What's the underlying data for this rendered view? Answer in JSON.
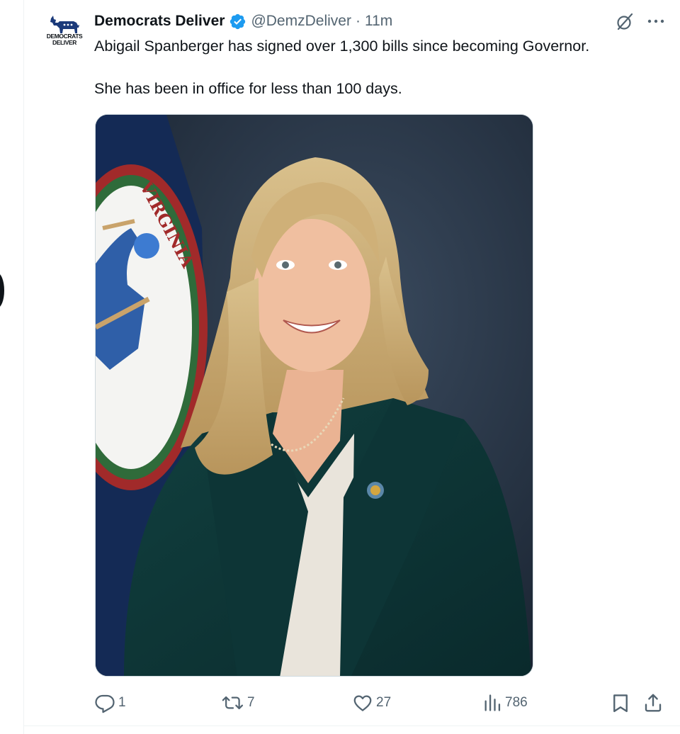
{
  "tweet": {
    "author": {
      "display_name": "Democrats Deliver",
      "handle": "@DemzDeliver",
      "verified": true,
      "avatar_text_line1": "DEMOCRATS",
      "avatar_text_line2": "DELIVER"
    },
    "separator": "·",
    "time_ago": "11m",
    "text_paragraph_1": "Abigail Spanberger has signed over 1,300 bills since becoming Governor.",
    "text_paragraph_2": "She has been in office for less than 100 days.",
    "media": {
      "seal_text": "VIRGINIA"
    },
    "actions": {
      "replies": "1",
      "reposts": "7",
      "likes": "27",
      "views": "786"
    }
  },
  "colors": {
    "text": "#0f1419",
    "secondary": "#536471",
    "verified_blue": "#1d9bf0",
    "divider": "#eff3f4"
  },
  "icons": [
    "verified-badge-icon",
    "grok-icon",
    "more-icon",
    "reply-icon",
    "repost-icon",
    "like-icon",
    "views-icon",
    "bookmark-icon",
    "share-icon"
  ]
}
